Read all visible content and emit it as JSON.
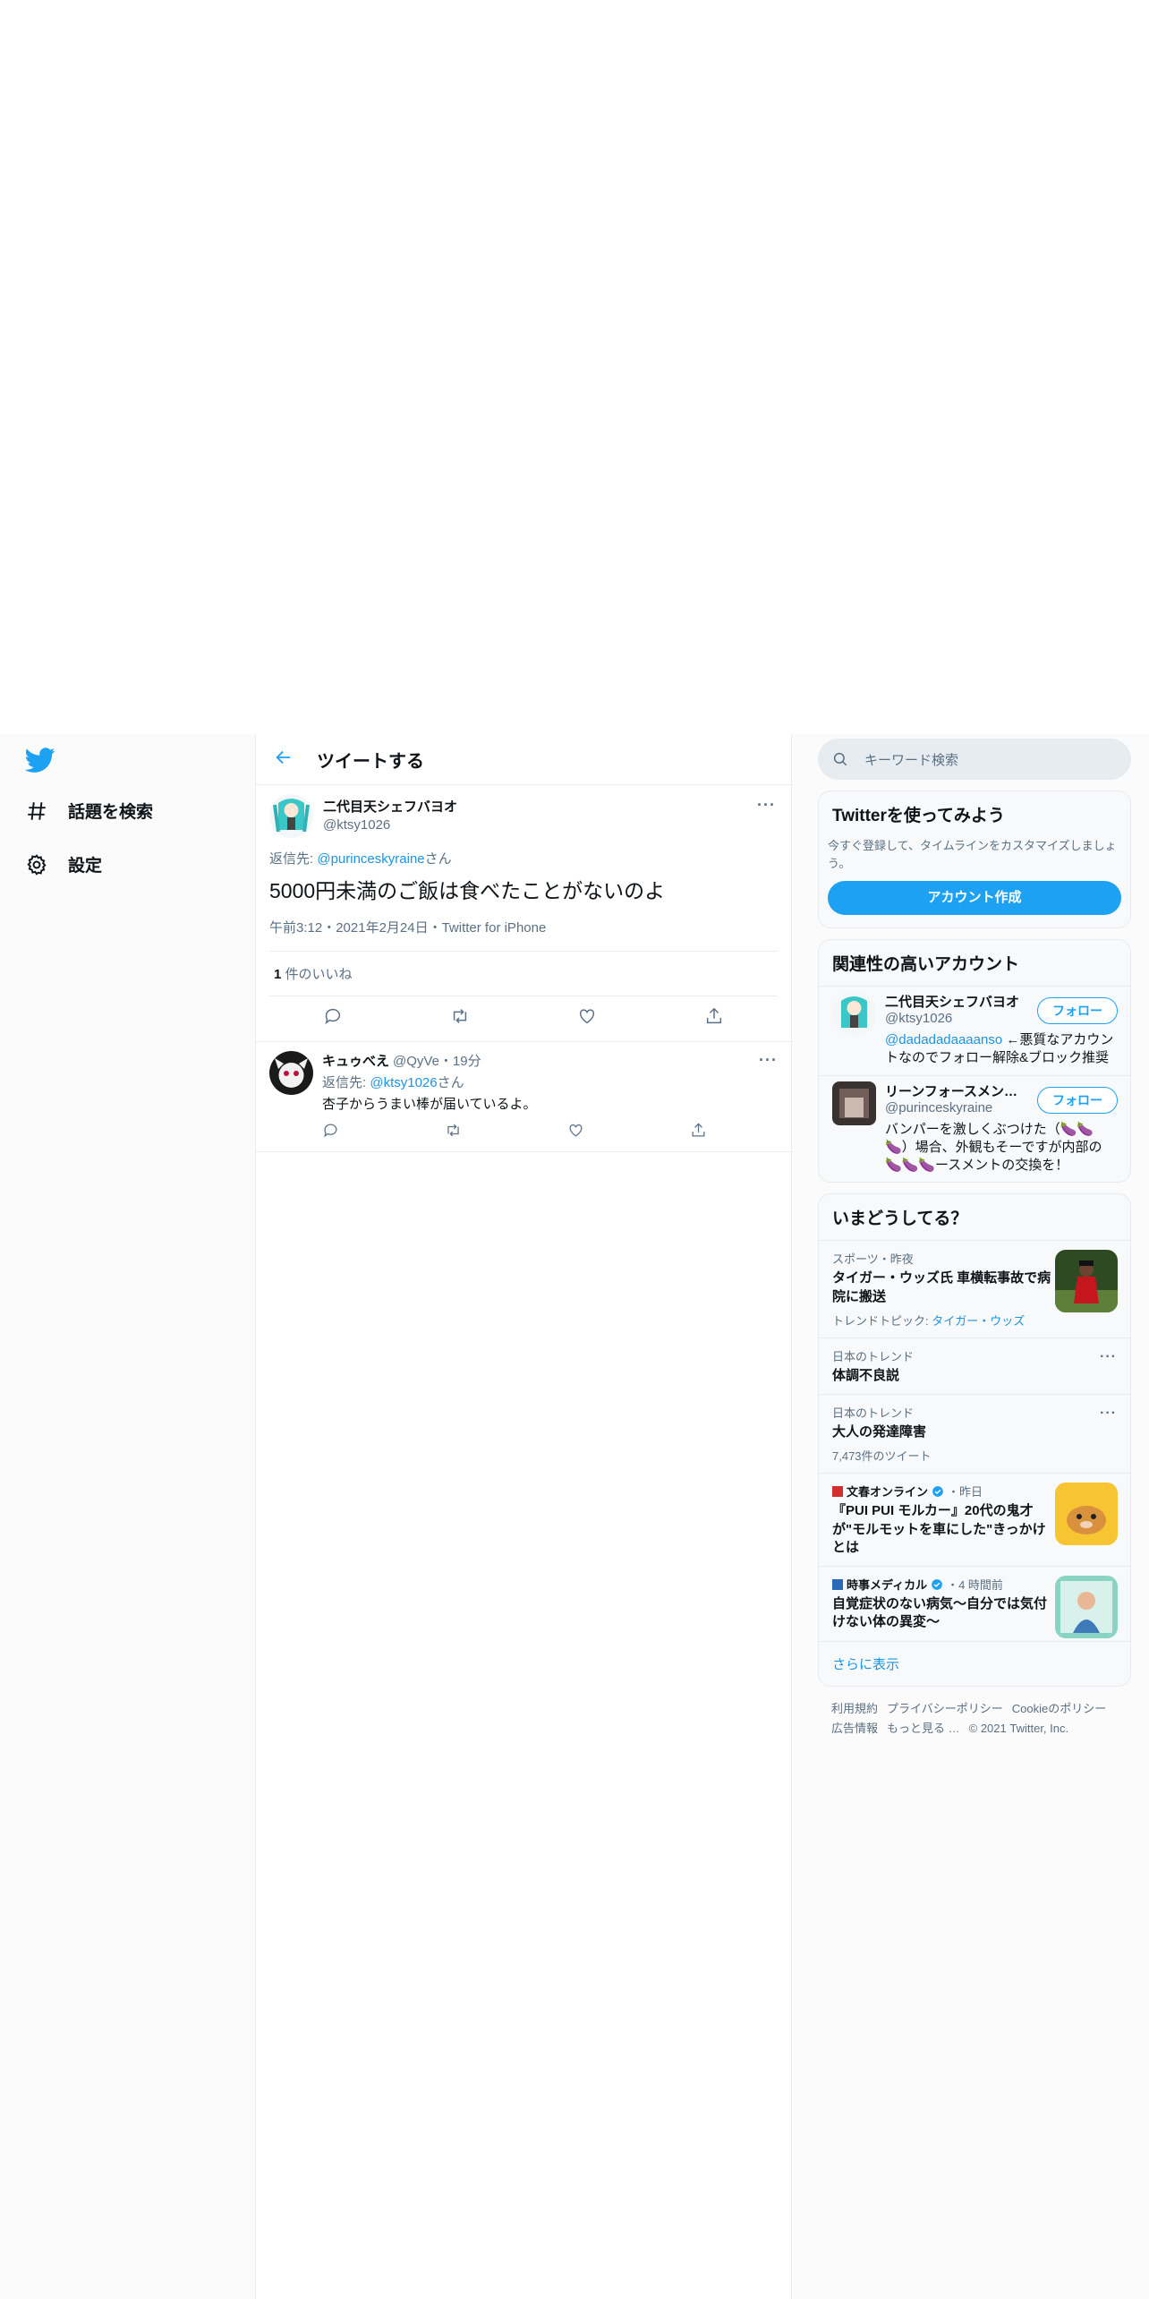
{
  "nav": {
    "items": [
      {
        "label": "話題を検索",
        "icon": "hashtag-icon"
      },
      {
        "label": "設定",
        "icon": "gear-icon"
      }
    ]
  },
  "header": {
    "title": "ツイートする"
  },
  "tweet": {
    "author_name": "二代目天シェフバヨオ",
    "author_handle": "@ktsy1026",
    "reply_prefix": "返信先: ",
    "reply_to": "@purinceskyraine",
    "reply_suffix": "さん",
    "text": "5000円未満のご飯は食べたことがないのよ",
    "meta": "午前3:12・2021年2月24日・Twitter for iPhone",
    "like_count": "1",
    "like_label": " 件のいいね"
  },
  "reply": {
    "name": "キュゥべえ",
    "handle_time": "@QyVe・19分",
    "reply_prefix": "返信先: ",
    "reply_to": "@ktsy1026",
    "reply_suffix": "さん",
    "text": "杏子からうまい棒が届いているよ。"
  },
  "search": {
    "placeholder": "キーワード検索"
  },
  "signup": {
    "title": "Twitterを使ってみよう",
    "sub": "今すぐ登録して、タイムラインをカスタマイズしましょう。",
    "button": "アカウント作成"
  },
  "related": {
    "title": "関連性の高いアカウント",
    "follow_label": "フォロー",
    "accounts": [
      {
        "name": "二代目天シェフバヨオ",
        "handle": "@ktsy1026",
        "bio_link": "@dadadadaaaanso",
        "bio": " ←悪質なアカウントなのでフォロー解除&ブロック推奨"
      },
      {
        "name": "リーンフォースメン…",
        "handle": "@purinceskyraine",
        "bio_link": "",
        "bio": "バンパーを激しくぶつけた（🍆🍆🍆）場合、外観もそーですが内部の🍆🍆🍆ースメントの交換を！"
      }
    ]
  },
  "trends": {
    "title": "いまどうしてる？",
    "items": [
      {
        "cat": "スポーツ・昨夜",
        "title": "タイガー・ウッズ氏 車横転事故で病院に搬送",
        "sub_prefix": "トレンドトピック: ",
        "sub_link": "タイガー・ウッズ"
      },
      {
        "cat": "日本のトレンド",
        "title": "体調不良説"
      },
      {
        "cat": "日本のトレンド",
        "title": "大人の発達障害",
        "sub": "7,473件のツイート"
      },
      {
        "source": "文春オンライン",
        "time": "・昨日",
        "title": "『PUI PUI モルカー』20代の鬼才が\"モルモットを車にした\"きっかけとは"
      },
      {
        "source": "時事メディカル",
        "time": "・4 時間前",
        "title": "自覚症状のない病気～自分では気付けない体の異変～"
      }
    ],
    "more": "さらに表示"
  },
  "footer": {
    "links": [
      "利用規約",
      "プライバシーポリシー",
      "Cookieのポリシー",
      "広告情報",
      "もっと見る …",
      "© 2021 Twitter, Inc."
    ]
  },
  "colors": {
    "accent": "#1da1f2",
    "link": "#1b95e0",
    "muted": "#5b7083",
    "border": "#e6ecf0"
  }
}
